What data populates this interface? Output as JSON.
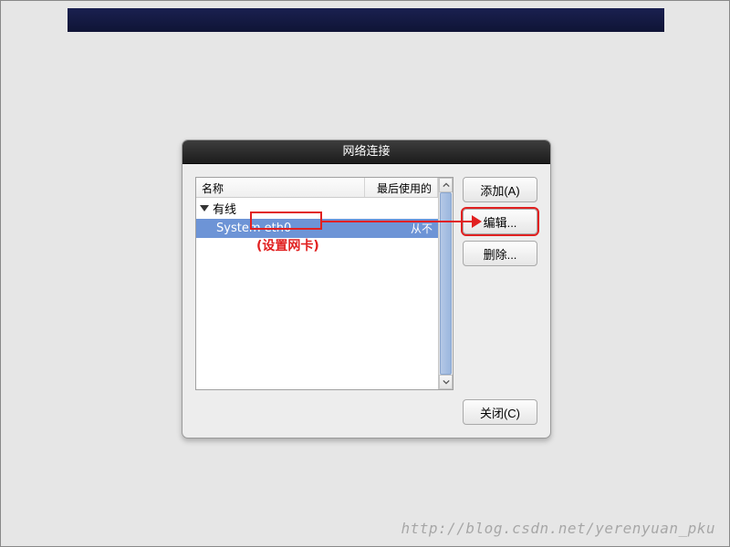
{
  "dialog": {
    "title": "网络连接",
    "columns": {
      "name": "名称",
      "last_used": "最后使用的"
    },
    "group": {
      "label": "有线"
    },
    "item": {
      "name": "System eth0",
      "last_used": "从不"
    },
    "buttons": {
      "add": "添加(A)",
      "edit": "编辑...",
      "delete": "删除...",
      "close": "关闭(C)"
    }
  },
  "annotation": {
    "setup_nic": "(设置网卡)"
  },
  "watermark": "http://blog.csdn.net/yerenyuan_pku"
}
